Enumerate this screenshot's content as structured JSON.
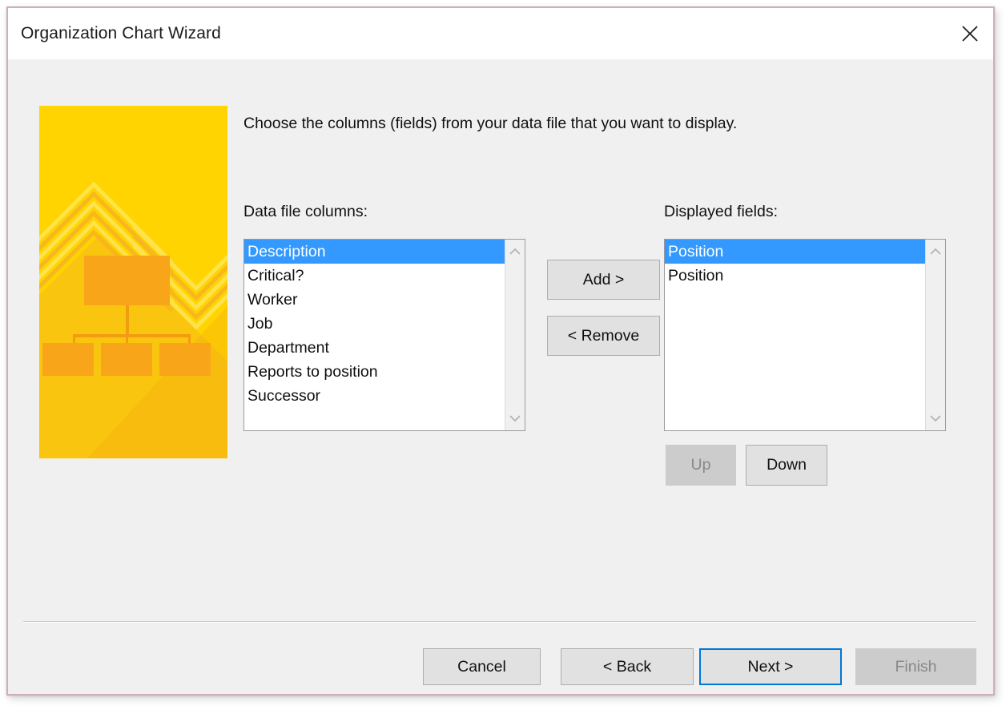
{
  "window": {
    "title": "Organization Chart Wizard",
    "close_icon": "close-icon"
  },
  "content": {
    "instruction": "Choose the columns (fields) from your data file that you want to display.",
    "left_label": "Data file columns:",
    "right_label": "Displayed fields:"
  },
  "data_file_columns": {
    "items": [
      {
        "label": "Description",
        "selected": true
      },
      {
        "label": "Critical?",
        "selected": false
      },
      {
        "label": "Worker",
        "selected": false
      },
      {
        "label": "Job",
        "selected": false
      },
      {
        "label": "Department",
        "selected": false
      },
      {
        "label": "Reports to position",
        "selected": false
      },
      {
        "label": "Successor",
        "selected": false
      }
    ]
  },
  "displayed_fields": {
    "items": [
      {
        "label": "Position",
        "selected": true
      },
      {
        "label": "Position",
        "selected": false
      }
    ]
  },
  "transfer_buttons": {
    "add": "Add >",
    "remove": "< Remove"
  },
  "order_buttons": {
    "up": "Up",
    "up_enabled": false,
    "down": "Down",
    "down_enabled": true
  },
  "footer_buttons": {
    "cancel": "Cancel",
    "back": "< Back",
    "next": "Next >",
    "finish": "Finish",
    "next_focused": true,
    "finish_enabled": false
  },
  "illustration": {
    "name": "org-chart-illustration",
    "base_color": "#ffd400",
    "accent_color": "#f9a51a",
    "shadow_color": "#f5b81a",
    "highlight_color": "#ffe34d"
  },
  "colors": {
    "dialog_border": "#cdafb4",
    "dialog_background": "#f0f0f0",
    "titlebar_background": "#ffffff",
    "selection_blue": "#3399ff",
    "focus_blue": "#0078d7",
    "button_face": "#e1e1e1",
    "button_border": "#adadad",
    "disabled_face": "#cccccc",
    "disabled_text": "#898989"
  }
}
